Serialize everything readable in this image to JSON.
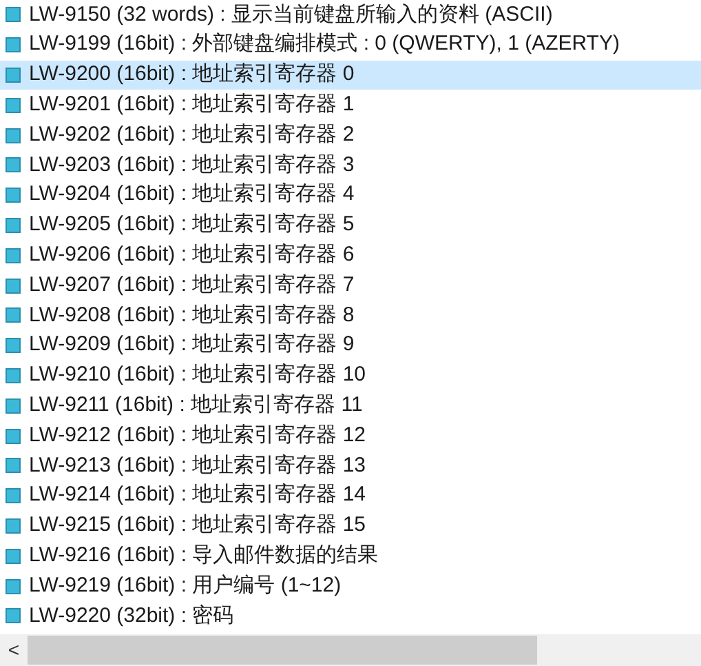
{
  "items": [
    {
      "label": "LW-9150 (32 words) : 显示当前键盘所输入的资料 (ASCII)",
      "selected": false
    },
    {
      "label": "LW-9199 (16bit) : 外部键盘编排模式 : 0 (QWERTY), 1 (AZERTY)",
      "selected": false
    },
    {
      "label": "LW-9200 (16bit) : 地址索引寄存器 0",
      "selected": true
    },
    {
      "label": "LW-9201 (16bit) : 地址索引寄存器 1",
      "selected": false
    },
    {
      "label": "LW-9202 (16bit) : 地址索引寄存器 2",
      "selected": false
    },
    {
      "label": "LW-9203 (16bit) : 地址索引寄存器 3",
      "selected": false
    },
    {
      "label": "LW-9204 (16bit) : 地址索引寄存器 4",
      "selected": false
    },
    {
      "label": "LW-9205 (16bit) : 地址索引寄存器 5",
      "selected": false
    },
    {
      "label": "LW-9206 (16bit) : 地址索引寄存器 6",
      "selected": false
    },
    {
      "label": "LW-9207 (16bit) : 地址索引寄存器 7",
      "selected": false
    },
    {
      "label": "LW-9208 (16bit) : 地址索引寄存器 8",
      "selected": false
    },
    {
      "label": "LW-9209 (16bit) : 地址索引寄存器 9",
      "selected": false
    },
    {
      "label": "LW-9210 (16bit) : 地址索引寄存器 10",
      "selected": false
    },
    {
      "label": "LW-9211 (16bit) : 地址索引寄存器 11",
      "selected": false
    },
    {
      "label": "LW-9212 (16bit) : 地址索引寄存器 12",
      "selected": false
    },
    {
      "label": "LW-9213 (16bit) : 地址索引寄存器 13",
      "selected": false
    },
    {
      "label": "LW-9214 (16bit) : 地址索引寄存器 14",
      "selected": false
    },
    {
      "label": "LW-9215 (16bit) : 地址索引寄存器 15",
      "selected": false
    },
    {
      "label": "LW-9216 (16bit) : 导入邮件数据的结果",
      "selected": false
    },
    {
      "label": "LW-9219 (16bit) : 用户编号 (1~12)",
      "selected": false
    },
    {
      "label": "LW-9220 (32bit) : 密码",
      "selected": false
    }
  ],
  "scrollbar": {
    "arrow": "<"
  }
}
